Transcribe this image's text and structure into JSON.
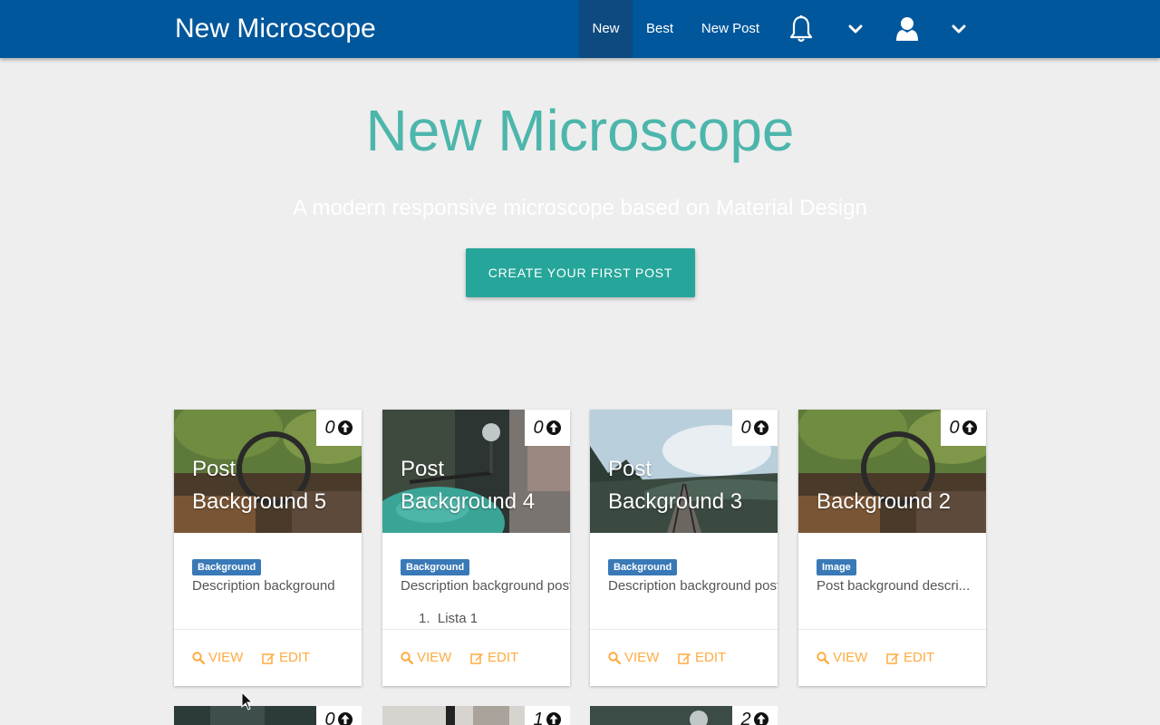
{
  "navbar": {
    "brand": "New Microscope",
    "items": [
      {
        "label": "New",
        "active": true
      },
      {
        "label": "Best",
        "active": false
      },
      {
        "label": "New Post",
        "active": false
      }
    ],
    "icons": [
      "bell-icon",
      "chevron-down-icon",
      "user-icon",
      "chevron-down-icon"
    ]
  },
  "hero": {
    "title": "New Microscope",
    "subtitle": "A modern responsive microscope based on Material Design",
    "cta_label": "CREATE YOUR FIRST POST"
  },
  "colors": {
    "primary": "#01579b",
    "accent": "#26a69a",
    "title": "#4db6ac",
    "action": "#ffab40",
    "badge": "#3a79b7"
  },
  "cards": [
    {
      "title_line1": "Post",
      "title_line2": "Background 5",
      "votes": "0",
      "badge": "Background",
      "description": "Description background",
      "list_item": "",
      "view_label": "VIEW",
      "edit_label": "EDIT"
    },
    {
      "title_line1": "Post",
      "title_line2": "Background 4",
      "votes": "0",
      "badge": "Background",
      "description": "Description background post",
      "list_item": "Lista 1",
      "view_label": "VIEW",
      "edit_label": "EDIT"
    },
    {
      "title_line1": "Post",
      "title_line2": "Background 3",
      "votes": "0",
      "badge": "Background",
      "description": "Description background post",
      "list_item": "",
      "view_label": "VIEW",
      "edit_label": "EDIT"
    },
    {
      "title_line1": "",
      "title_line2": "Background 2",
      "votes": "0",
      "badge": "Image",
      "description": "Post background descri...",
      "list_item": "",
      "view_label": "VIEW",
      "edit_label": "EDIT"
    }
  ],
  "partial_cards": [
    {
      "votes": "0"
    },
    {
      "votes": "1"
    },
    {
      "votes": "2"
    }
  ]
}
